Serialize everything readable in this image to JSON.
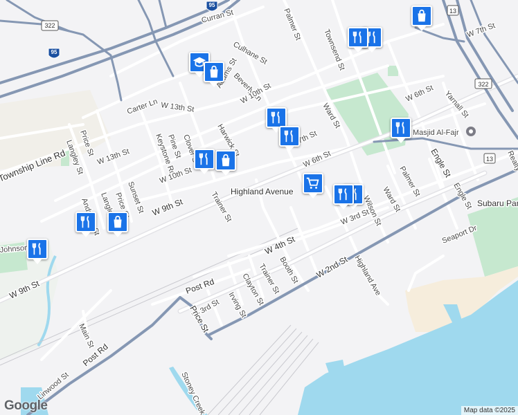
{
  "map": {
    "logo": "Google",
    "credit": "Map data ©2025",
    "highway_shields": {
      "interstate_a": "95",
      "interstate_b": "95",
      "route_322_a": "322",
      "route_322_b": "322",
      "us_13_a": "13",
      "us_13_b": "13"
    },
    "labels": {
      "curran_st": "Curran St",
      "palmer_st_n": "Palmer St",
      "townsend_st": "Townsend St",
      "w_7th_st_ne": "W 7th St",
      "culhane_st": "Culhane St",
      "beverly_ln": "Beverly Ln",
      "adams_st": "Adams St",
      "w_10th_st": "W 10th St",
      "carter_ln": "Carter Ln",
      "w_13th_st": "W 13th St",
      "ward_st_n": "Ward St",
      "w_6th_st_e": "W 6th St",
      "yarnall_st": "Yarnall St",
      "masjid": "Masjid Al-Fajr",
      "township_line_rd": "Township Line Rd",
      "price_st_n": "Price St",
      "langley_st": "Langley St",
      "w_13th_st_w": "W 13th St",
      "keystone_rd": "Keystone Rd",
      "pine_st": "Pine St",
      "clover_st": "Clover St",
      "harwick_st": "Harwick St",
      "w_7th_st_c": "W 7th St",
      "w_6th_st_c": "W 6th St",
      "w_10th_st_w": "W 10th St",
      "highland_avenue": "Highland Avenue",
      "engle_st": "Engle St",
      "engle_st_2": "Engle St",
      "palmer_st_s": "Palmer St",
      "ward_st_s": "Ward St",
      "wilson_st": "Wilson St",
      "w_3rd_st_e": "W 3rd St",
      "sunset_st": "Sunset St",
      "price_st_c": "Price St",
      "langley_st_2": "Langley St",
      "andrews_st": "Andrews St",
      "trainer_st_n": "Trainer St",
      "w_9th_st_c": "W 9th St",
      "subaru_park": "Subaru Park",
      "seaport_dr": "Seaport Dr",
      "w_4th_st": "W 4th St",
      "johnson_st": "Johnson St",
      "w_9th_st_w": "W 9th St",
      "post_rd_n": "Post Rd",
      "booth_st": "Booth St",
      "w_2nd_st": "W 2nd St",
      "highland_ave_s": "Highland Ave",
      "trainer_st_s": "Trainer St",
      "clayton_st": "Clayton St",
      "irving_st": "Irving St",
      "w_3rd_st_w": "W 3rd St",
      "price_st_s": "Price St",
      "main_st": "Main St",
      "post_rd_s": "Post Rd",
      "linwood_st": "Linwood St",
      "stoney_creek": "Stoney Creek",
      "realty": "Realty"
    },
    "pois": [
      {
        "type": "shopping",
        "icon": "shopping-bag-icon"
      },
      {
        "type": "restaurant",
        "icon": "fork-knife-icon"
      },
      {
        "type": "restaurant",
        "icon": "fork-knife-icon"
      },
      {
        "type": "school",
        "icon": "school-icon"
      },
      {
        "type": "shopping",
        "icon": "shopping-bag-icon"
      },
      {
        "type": "restaurant",
        "icon": "fork-knife-icon"
      },
      {
        "type": "restaurant",
        "icon": "fork-knife-icon"
      },
      {
        "type": "restaurant",
        "icon": "fork-knife-icon"
      },
      {
        "type": "restaurant",
        "icon": "fork-knife-icon"
      },
      {
        "type": "shopping",
        "icon": "shopping-bag-icon"
      },
      {
        "type": "grocery",
        "icon": "shopping-cart-icon"
      },
      {
        "type": "restaurant",
        "icon": "fork-knife-icon"
      },
      {
        "type": "restaurant",
        "icon": "fork-knife-icon"
      },
      {
        "type": "restaurant",
        "icon": "fork-knife-icon"
      },
      {
        "type": "shopping",
        "icon": "shopping-bag-icon"
      },
      {
        "type": "restaurant",
        "icon": "fork-knife-icon"
      }
    ],
    "colors": {
      "water": "#9fd9ee",
      "park": "#c6e8cf",
      "sand": "#f6eddc",
      "land": "#f3f3f5",
      "highway": "#8597b3",
      "road": "#ffffff",
      "poi": "#1a73e8"
    }
  }
}
